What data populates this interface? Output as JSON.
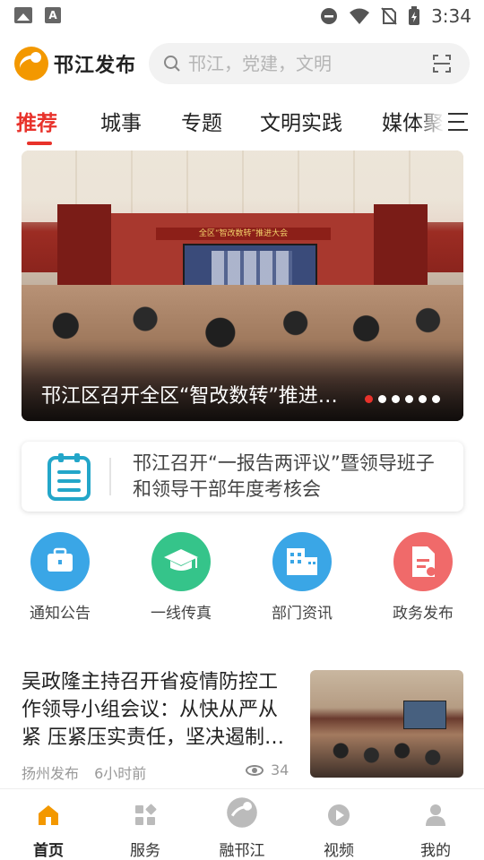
{
  "status_bar": {
    "time": "3:34",
    "icons": [
      "image-icon",
      "a-app-icon",
      "do-not-disturb-icon",
      "wifi-icon",
      "no-sim-icon",
      "battery-charging-icon"
    ]
  },
  "header": {
    "app_name": "邗江发布",
    "search_placeholder": "邗江，党建，文明",
    "icons": [
      "search-icon",
      "scan-icon"
    ]
  },
  "tabs": [
    {
      "label": "推荐",
      "active": true
    },
    {
      "label": "城事",
      "active": false
    },
    {
      "label": "专题",
      "active": false
    },
    {
      "label": "文明实践",
      "active": false
    },
    {
      "label": "媒体聚",
      "active": false
    }
  ],
  "banner": {
    "title": "邗江区召开全区“智改数转”推进大会",
    "sign_text": "全区“智改数转”推进大会",
    "slide_count": 6,
    "active_index": 0,
    "active_dot_color": "#e8322b"
  },
  "notice": {
    "text": "邗江召开“一报告两评议”暨领导班子和领导干部年度考核会",
    "icon": "clipboard-list-icon"
  },
  "quick_entries": [
    {
      "label": "通知公告",
      "icon": "briefcase-icon",
      "color": "#3aa6e6"
    },
    {
      "label": "一线传真",
      "icon": "graduation-cap-icon",
      "color": "#35c48a"
    },
    {
      "label": "部门资讯",
      "icon": "buildings-icon",
      "color": "#3aa6e6"
    },
    {
      "label": "政务发布",
      "icon": "document-icon",
      "color": "#f06a6a"
    }
  ],
  "news": [
    {
      "title": "吴政隆主持召开省疫情防控工作领导小组会议：从快从严从紧 压紧压实责任，坚决遏制疫情扩散蔓延",
      "source": "扬州发布",
      "time": "6小时前",
      "views": "34"
    }
  ],
  "bottom_nav": [
    {
      "label": "首页",
      "icon": "home-icon",
      "active": true
    },
    {
      "label": "服务",
      "icon": "services-grid-icon",
      "active": false
    },
    {
      "label": "融邗江",
      "icon": "brand-logo-icon",
      "active": false
    },
    {
      "label": "视频",
      "icon": "play-circle-icon",
      "active": false
    },
    {
      "label": "我的",
      "icon": "person-icon",
      "active": false
    }
  ],
  "colors": {
    "accent": "#e8322b",
    "brand_orange": "#f39800"
  }
}
